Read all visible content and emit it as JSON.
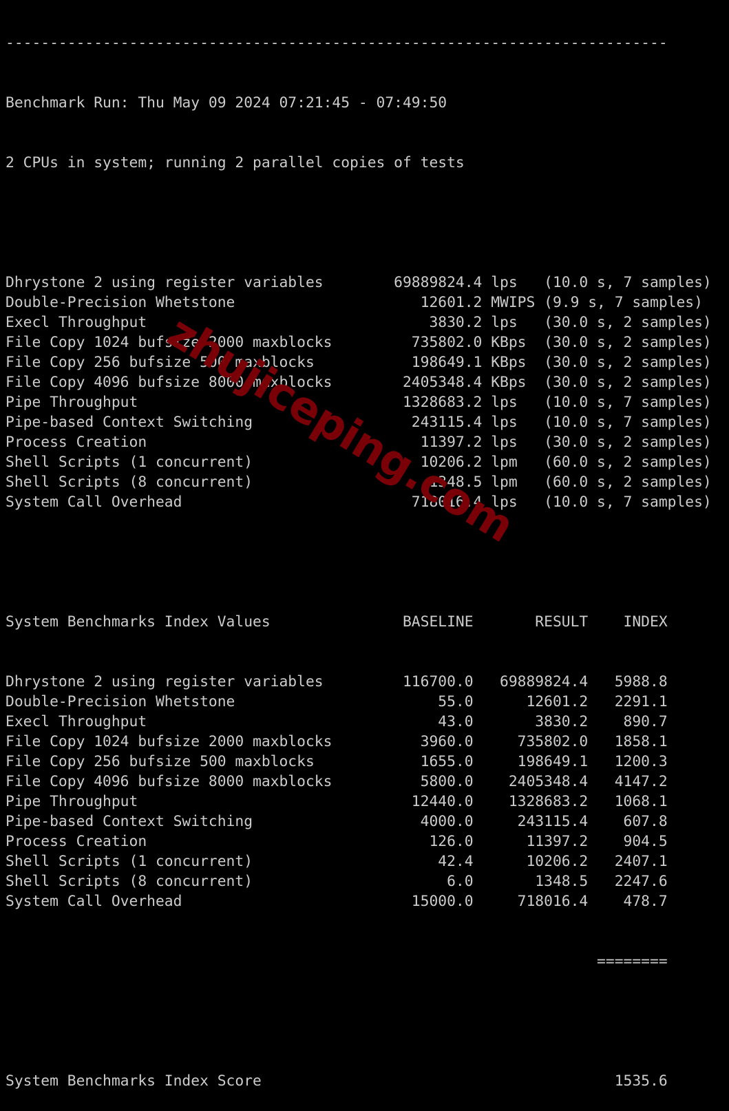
{
  "separator": "---------------------------------------------------------------------------",
  "header": {
    "run": "Benchmark Run: Thu May 09 2024 07:21:45 - 07:49:50",
    "cpus": "2 CPUs in system; running 2 parallel copies of tests"
  },
  "results": [
    {
      "name": "Dhrystone 2 using register variables",
      "value": "69889824.4",
      "unit": "lps",
      "timing": "(10.0 s, 7 samples)"
    },
    {
      "name": "Double-Precision Whetstone",
      "value": "12601.2",
      "unit": "MWIPS",
      "timing": "(9.9 s, 7 samples)"
    },
    {
      "name": "Execl Throughput",
      "value": "3830.2",
      "unit": "lps",
      "timing": "(30.0 s, 2 samples)"
    },
    {
      "name": "File Copy 1024 bufsize 2000 maxblocks",
      "value": "735802.0",
      "unit": "KBps",
      "timing": "(30.0 s, 2 samples)"
    },
    {
      "name": "File Copy 256 bufsize 500 maxblocks",
      "value": "198649.1",
      "unit": "KBps",
      "timing": "(30.0 s, 2 samples)"
    },
    {
      "name": "File Copy 4096 bufsize 8000 maxblocks",
      "value": "2405348.4",
      "unit": "KBps",
      "timing": "(30.0 s, 2 samples)"
    },
    {
      "name": "Pipe Throughput",
      "value": "1328683.2",
      "unit": "lps",
      "timing": "(10.0 s, 7 samples)"
    },
    {
      "name": "Pipe-based Context Switching",
      "value": "243115.4",
      "unit": "lps",
      "timing": "(10.0 s, 7 samples)"
    },
    {
      "name": "Process Creation",
      "value": "11397.2",
      "unit": "lps",
      "timing": "(30.0 s, 2 samples)"
    },
    {
      "name": "Shell Scripts (1 concurrent)",
      "value": "10206.2",
      "unit": "lpm",
      "timing": "(60.0 s, 2 samples)"
    },
    {
      "name": "Shell Scripts (8 concurrent)",
      "value": "1348.5",
      "unit": "lpm",
      "timing": "(60.0 s, 2 samples)"
    },
    {
      "name": "System Call Overhead",
      "value": "718016.4",
      "unit": "lps",
      "timing": "(10.0 s, 7 samples)"
    }
  ],
  "index_table": {
    "title": "System Benchmarks Index Values",
    "columns": [
      "BASELINE",
      "RESULT",
      "INDEX"
    ],
    "rows": [
      {
        "name": "Dhrystone 2 using register variables",
        "baseline": "116700.0",
        "result": "69889824.4",
        "index": "5988.8"
      },
      {
        "name": "Double-Precision Whetstone",
        "baseline": "55.0",
        "result": "12601.2",
        "index": "2291.1"
      },
      {
        "name": "Execl Throughput",
        "baseline": "43.0",
        "result": "3830.2",
        "index": "890.7"
      },
      {
        "name": "File Copy 1024 bufsize 2000 maxblocks",
        "baseline": "3960.0",
        "result": "735802.0",
        "index": "1858.1"
      },
      {
        "name": "File Copy 256 bufsize 500 maxblocks",
        "baseline": "1655.0",
        "result": "198649.1",
        "index": "1200.3"
      },
      {
        "name": "File Copy 4096 bufsize 8000 maxblocks",
        "baseline": "5800.0",
        "result": "2405348.4",
        "index": "4147.2"
      },
      {
        "name": "Pipe Throughput",
        "baseline": "12440.0",
        "result": "1328683.2",
        "index": "1068.1"
      },
      {
        "name": "Pipe-based Context Switching",
        "baseline": "4000.0",
        "result": "243115.4",
        "index": "607.8"
      },
      {
        "name": "Process Creation",
        "baseline": "126.0",
        "result": "11397.2",
        "index": "904.5"
      },
      {
        "name": "Shell Scripts (1 concurrent)",
        "baseline": "42.4",
        "result": "10206.2",
        "index": "2407.1"
      },
      {
        "name": "Shell Scripts (8 concurrent)",
        "baseline": "6.0",
        "result": "1348.5",
        "index": "2247.6"
      },
      {
        "name": "System Call Overhead",
        "baseline": "15000.0",
        "result": "718016.4",
        "index": "478.7"
      }
    ],
    "rule": "========",
    "score_label": "System Benchmarks Index Score",
    "score": "1535.6"
  },
  "watermark": "zhujiceping.com"
}
